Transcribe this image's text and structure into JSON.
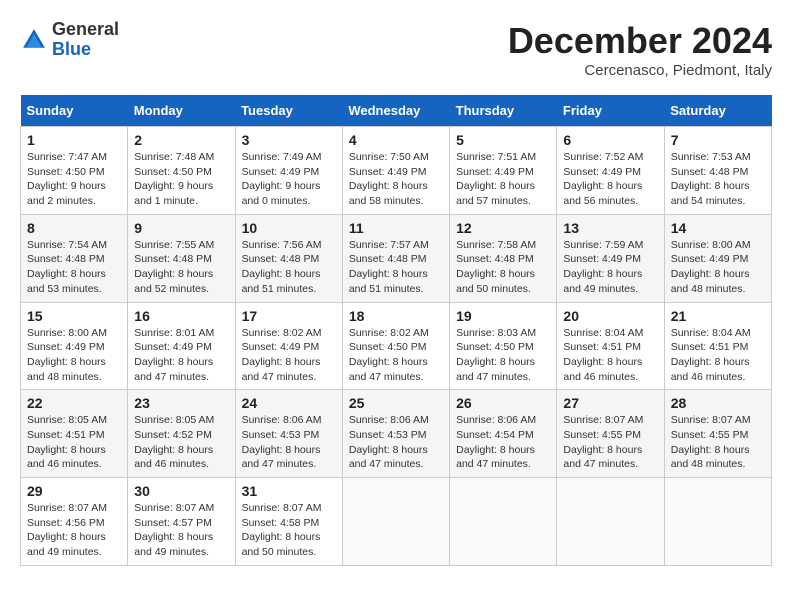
{
  "header": {
    "logo_general": "General",
    "logo_blue": "Blue",
    "title": "December 2024",
    "location": "Cercenasco, Piedmont, Italy"
  },
  "calendar": {
    "days_of_week": [
      "Sunday",
      "Monday",
      "Tuesday",
      "Wednesday",
      "Thursday",
      "Friday",
      "Saturday"
    ],
    "weeks": [
      [
        {
          "day": "",
          "info": ""
        },
        {
          "day": "",
          "info": ""
        },
        {
          "day": "",
          "info": ""
        },
        {
          "day": "",
          "info": ""
        },
        {
          "day": "",
          "info": ""
        },
        {
          "day": "",
          "info": ""
        },
        {
          "day": "",
          "info": ""
        }
      ],
      [
        {
          "day": "1",
          "info": "Sunrise: 7:47 AM\nSunset: 4:50 PM\nDaylight: 9 hours\nand 2 minutes."
        },
        {
          "day": "2",
          "info": "Sunrise: 7:48 AM\nSunset: 4:50 PM\nDaylight: 9 hours\nand 1 minute."
        },
        {
          "day": "3",
          "info": "Sunrise: 7:49 AM\nSunset: 4:49 PM\nDaylight: 9 hours\nand 0 minutes."
        },
        {
          "day": "4",
          "info": "Sunrise: 7:50 AM\nSunset: 4:49 PM\nDaylight: 8 hours\nand 58 minutes."
        },
        {
          "day": "5",
          "info": "Sunrise: 7:51 AM\nSunset: 4:49 PM\nDaylight: 8 hours\nand 57 minutes."
        },
        {
          "day": "6",
          "info": "Sunrise: 7:52 AM\nSunset: 4:49 PM\nDaylight: 8 hours\nand 56 minutes."
        },
        {
          "day": "7",
          "info": "Sunrise: 7:53 AM\nSunset: 4:48 PM\nDaylight: 8 hours\nand 54 minutes."
        }
      ],
      [
        {
          "day": "8",
          "info": "Sunrise: 7:54 AM\nSunset: 4:48 PM\nDaylight: 8 hours\nand 53 minutes."
        },
        {
          "day": "9",
          "info": "Sunrise: 7:55 AM\nSunset: 4:48 PM\nDaylight: 8 hours\nand 52 minutes."
        },
        {
          "day": "10",
          "info": "Sunrise: 7:56 AM\nSunset: 4:48 PM\nDaylight: 8 hours\nand 51 minutes."
        },
        {
          "day": "11",
          "info": "Sunrise: 7:57 AM\nSunset: 4:48 PM\nDaylight: 8 hours\nand 51 minutes."
        },
        {
          "day": "12",
          "info": "Sunrise: 7:58 AM\nSunset: 4:48 PM\nDaylight: 8 hours\nand 50 minutes."
        },
        {
          "day": "13",
          "info": "Sunrise: 7:59 AM\nSunset: 4:49 PM\nDaylight: 8 hours\nand 49 minutes."
        },
        {
          "day": "14",
          "info": "Sunrise: 8:00 AM\nSunset: 4:49 PM\nDaylight: 8 hours\nand 48 minutes."
        }
      ],
      [
        {
          "day": "15",
          "info": "Sunrise: 8:00 AM\nSunset: 4:49 PM\nDaylight: 8 hours\nand 48 minutes."
        },
        {
          "day": "16",
          "info": "Sunrise: 8:01 AM\nSunset: 4:49 PM\nDaylight: 8 hours\nand 47 minutes."
        },
        {
          "day": "17",
          "info": "Sunrise: 8:02 AM\nSunset: 4:49 PM\nDaylight: 8 hours\nand 47 minutes."
        },
        {
          "day": "18",
          "info": "Sunrise: 8:02 AM\nSunset: 4:50 PM\nDaylight: 8 hours\nand 47 minutes."
        },
        {
          "day": "19",
          "info": "Sunrise: 8:03 AM\nSunset: 4:50 PM\nDaylight: 8 hours\nand 47 minutes."
        },
        {
          "day": "20",
          "info": "Sunrise: 8:04 AM\nSunset: 4:51 PM\nDaylight: 8 hours\nand 46 minutes."
        },
        {
          "day": "21",
          "info": "Sunrise: 8:04 AM\nSunset: 4:51 PM\nDaylight: 8 hours\nand 46 minutes."
        }
      ],
      [
        {
          "day": "22",
          "info": "Sunrise: 8:05 AM\nSunset: 4:51 PM\nDaylight: 8 hours\nand 46 minutes."
        },
        {
          "day": "23",
          "info": "Sunrise: 8:05 AM\nSunset: 4:52 PM\nDaylight: 8 hours\nand 46 minutes."
        },
        {
          "day": "24",
          "info": "Sunrise: 8:06 AM\nSunset: 4:53 PM\nDaylight: 8 hours\nand 47 minutes."
        },
        {
          "day": "25",
          "info": "Sunrise: 8:06 AM\nSunset: 4:53 PM\nDaylight: 8 hours\nand 47 minutes."
        },
        {
          "day": "26",
          "info": "Sunrise: 8:06 AM\nSunset: 4:54 PM\nDaylight: 8 hours\nand 47 minutes."
        },
        {
          "day": "27",
          "info": "Sunrise: 8:07 AM\nSunset: 4:55 PM\nDaylight: 8 hours\nand 47 minutes."
        },
        {
          "day": "28",
          "info": "Sunrise: 8:07 AM\nSunset: 4:55 PM\nDaylight: 8 hours\nand 48 minutes."
        }
      ],
      [
        {
          "day": "29",
          "info": "Sunrise: 8:07 AM\nSunset: 4:56 PM\nDaylight: 8 hours\nand 49 minutes."
        },
        {
          "day": "30",
          "info": "Sunrise: 8:07 AM\nSunset: 4:57 PM\nDaylight: 8 hours\nand 49 minutes."
        },
        {
          "day": "31",
          "info": "Sunrise: 8:07 AM\nSunset: 4:58 PM\nDaylight: 8 hours\nand 50 minutes."
        },
        {
          "day": "",
          "info": ""
        },
        {
          "day": "",
          "info": ""
        },
        {
          "day": "",
          "info": ""
        },
        {
          "day": "",
          "info": ""
        }
      ]
    ]
  }
}
